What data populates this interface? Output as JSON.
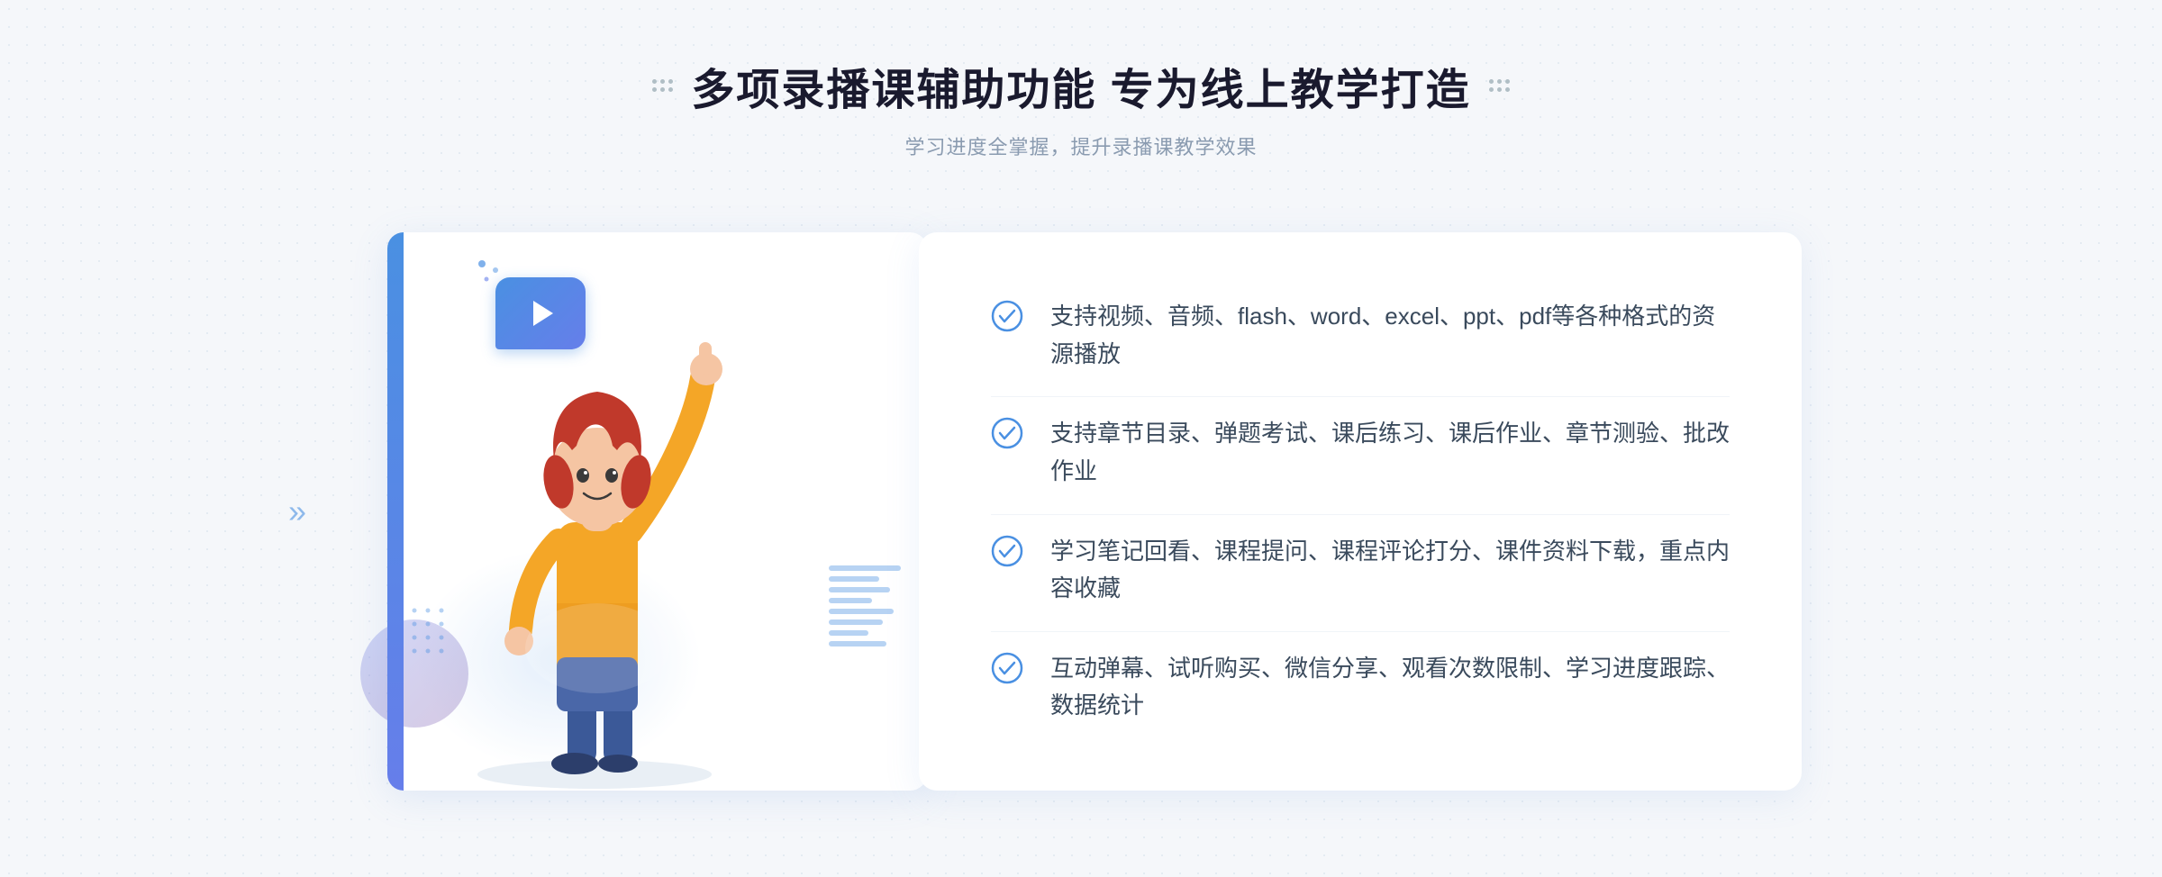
{
  "header": {
    "title": "多项录播课辅助功能 专为线上教学打造",
    "subtitle": "学习进度全掌握，提升录播课教学效果",
    "decorator_left": "⁝⁝",
    "decorator_right": "⁝⁝"
  },
  "features": [
    {
      "id": "feature-1",
      "text": "支持视频、音频、flash、word、excel、ppt、pdf等各种格式的资源播放"
    },
    {
      "id": "feature-2",
      "text": "支持章节目录、弹题考试、课后练习、课后作业、章节测验、批改作业"
    },
    {
      "id": "feature-3",
      "text": "学习笔记回看、课程提问、课程评论打分、课件资料下载，重点内容收藏"
    },
    {
      "id": "feature-4",
      "text": "互动弹幕、试听购买、微信分享、观看次数限制、学习进度跟踪、数据统计"
    }
  ],
  "colors": {
    "primary": "#4a90e2",
    "secondary": "#667eea",
    "text_dark": "#1a1a2e",
    "text_medium": "#3a4a5c",
    "text_light": "#8a9bb0",
    "white": "#ffffff",
    "bg": "#f5f7fa"
  },
  "icons": {
    "check": "check-circle",
    "play": "play-triangle",
    "left_arrow": "double-chevron-left"
  }
}
